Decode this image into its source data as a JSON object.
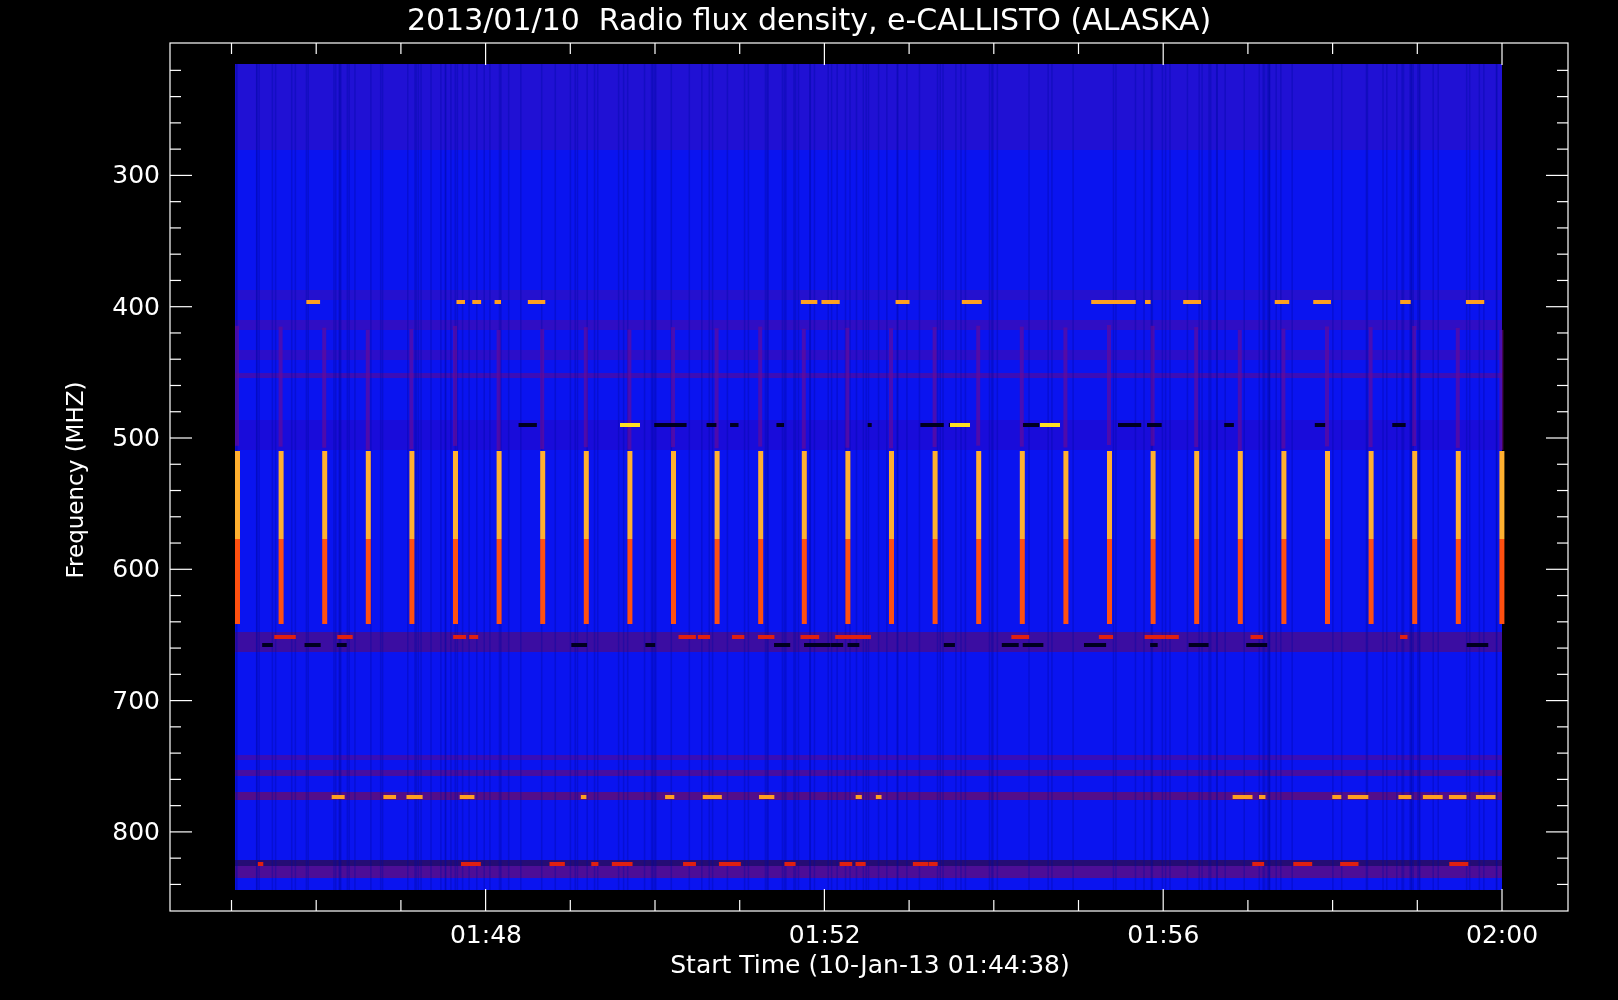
{
  "title": "2013/01/10  Radio flux density, e-CALLISTO (ALASKA)",
  "y_axis": {
    "label": "Frequency (MHZ)",
    "ticks": [
      "300",
      "400",
      "500",
      "600",
      "700",
      "800"
    ]
  },
  "x_axis": {
    "label": "Start Time (10-Jan-13 01:44:38)",
    "ticks": [
      "01:48",
      "01:52",
      "01:56",
      "02:00"
    ]
  }
}
